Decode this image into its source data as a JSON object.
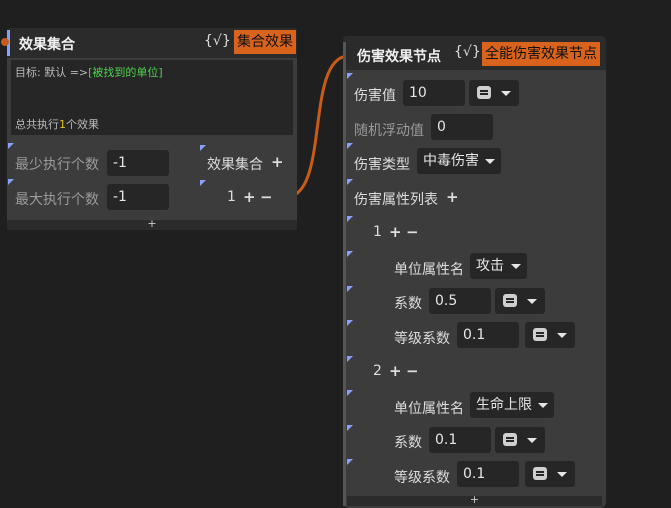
{
  "collection_node": {
    "title": "效果集合",
    "fx_icon": "{√}",
    "badge": "集合效果",
    "target_prefix": "目标: 默认 =>",
    "target_value": "[被找到的单位]",
    "summary_prefix": "总共执行",
    "summary_count": "1",
    "summary_suffix": "个效果",
    "min_label": "最少执行个数",
    "min_value": "-1",
    "max_label": "最大执行个数",
    "max_value": "-1",
    "effects_label": "效果集合",
    "effect_index": "1",
    "footer_symbol": "+"
  },
  "damage_node": {
    "title": "伤害效果节点",
    "fx_icon": "{√}",
    "badge": "全能伤害效果节点",
    "damage_label": "伤害值",
    "damage_value": "10",
    "random_label": "随机浮动值",
    "random_value": "0",
    "type_label": "伤害类型",
    "type_value": "中毒伤害",
    "attr_list_label": "伤害属性列表",
    "items": [
      {
        "index": "1",
        "attr_label": "单位属性名",
        "attr_value": "攻击",
        "coef_label": "系数",
        "coef_value": "0.5",
        "level_label": "等级系数",
        "level_value": "0.1"
      },
      {
        "index": "2",
        "attr_label": "单位属性名",
        "attr_value": "生命上限",
        "coef_label": "系数",
        "coef_value": "0.1",
        "level_label": "等级系数",
        "level_value": "0.1"
      }
    ],
    "footer_symbol": "+"
  },
  "icons": {
    "plus": "+",
    "minus": "−"
  },
  "colors": {
    "accent": "#d9621c",
    "port": "#8aa0ff",
    "link": "#c85a1a",
    "target_green": "#4fd24f",
    "count_yellow": "#e0c020"
  }
}
